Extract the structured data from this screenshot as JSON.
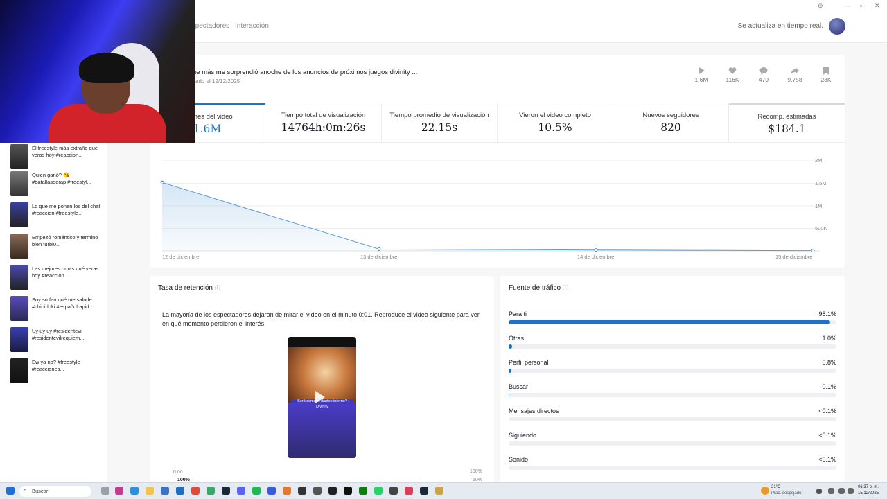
{
  "header": {
    "tabs": [
      "Espectadores",
      "Interacción"
    ],
    "realtime_note": "Se actualiza en tiempo real."
  },
  "video": {
    "title": "ue más me sorprendió anoche de los anuncios de próximos juegos divinity ...",
    "date": "cado el 12/12/2025",
    "stats": {
      "views": "1.6M",
      "likes": "116K",
      "comments": "479",
      "shares": "9,758",
      "saves": "23K"
    }
  },
  "metrics": [
    {
      "label": "aciones del video",
      "value": "1.6M"
    },
    {
      "label": "Tiempo total de visualización",
      "value": "14764h:0m:26s"
    },
    {
      "label": "Tiempo promedio de visualización",
      "value": "22.15s"
    },
    {
      "label": "Vieron el video completo",
      "value": "10.5%"
    },
    {
      "label": "Nuevos seguidores",
      "value": "820"
    },
    {
      "label": "Recomp. estimadas",
      "value": "$184.1"
    }
  ],
  "chart_data": {
    "type": "area",
    "x": [
      "12 de diciembre",
      "13 de diciembre",
      "14 de diciembre",
      "15 de diciembre"
    ],
    "series": [
      {
        "values": [
          1520000,
          40000,
          20000,
          5000
        ]
      }
    ],
    "yticks": [
      "2M",
      "1.5M",
      "1M",
      "500K"
    ],
    "ylim": [
      0,
      2000000
    ],
    "color": "#1a73c8"
  },
  "sidebar": {
    "items": [
      {
        "text": "El freestyle más extraño qué veras hoy #reaccion..."
      },
      {
        "text": "Quien ganó? 😘 #batallasderap #freestyl..."
      },
      {
        "text": "Lo que me ponen los del chat #reaccion #freestyle..."
      },
      {
        "text": "Empezó romántico y termino bien turbi0..."
      },
      {
        "text": "Las mejores rimas qué veras hoy #reaccion..."
      },
      {
        "text": "Soy su fan qué me salude #chibidoki #españolrapid..."
      },
      {
        "text": "Uy uy uy #residentevil #residentevilrequiem..."
      },
      {
        "text": "Ew ya no? #freestyle #reacciones..."
      }
    ]
  },
  "retention": {
    "title": "Tasa de retención",
    "description": "La mayoría de los espectadores dejaron de mirar el video en el minuto 0:01. Reproduce el video siguiente para ver en qué momento perdieron el interés",
    "video_caption": "Será como el dantes inferno?",
    "video_sub": "Divinity",
    "time_label": "0:00",
    "pct_label": "100%",
    "axis_top": "100%",
    "axis_mid": "50%"
  },
  "traffic": {
    "title": "Fuente de tráfico",
    "sources": [
      {
        "label": "Para ti",
        "value": "98.1%",
        "fill": 0.981
      },
      {
        "label": "Otras",
        "value": "1.0%",
        "fill": 0.01
      },
      {
        "label": "Perfil personal",
        "value": "0.8%",
        "fill": 0.008
      },
      {
        "label": "Buscar",
        "value": "0.1%",
        "fill": 0.001
      },
      {
        "label": "Mensajes directos",
        "value": "<0.1%",
        "fill": 0.0
      },
      {
        "label": "Siguiendo",
        "value": "<0.1%",
        "fill": 0.0
      },
      {
        "label": "Sonido",
        "value": "<0.1%",
        "fill": 0.0
      }
    ]
  },
  "taskbar": {
    "search": "Buscar",
    "weather_temp": "21°C",
    "weather_desc": "Prac. despejado",
    "time": "06:37 p. m.",
    "date": "15/12/2025"
  }
}
